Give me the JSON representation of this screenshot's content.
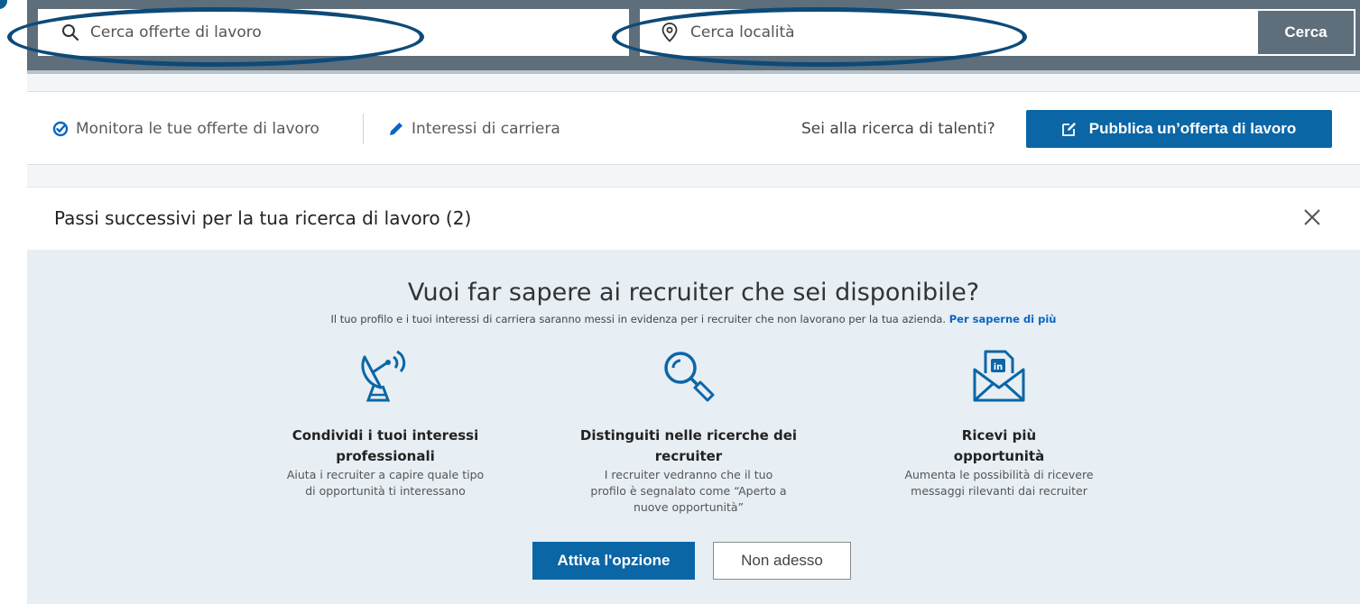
{
  "search": {
    "job_placeholder": "Cerca offerte di lavoro",
    "location_placeholder": "Cerca località",
    "button_label": "Cerca"
  },
  "nav": {
    "track_jobs": "Monitora le tue offerte di lavoro",
    "career_interests": "Interessi di carriera",
    "talent_question": "Sei alla ricerca di talenti?",
    "post_job": "Pubblica un’offerta di lavoro"
  },
  "next_steps": {
    "title": "Passi successivi per la tua ricerca di lavoro (2)"
  },
  "promo": {
    "title": "Vuoi far sapere ai recruiter che sei disponibile?",
    "description": "Il tuo profilo e i tuoi interessi di carriera saranno messi in evidenza per i recruiter che non lavorano per la tua azienda.",
    "learn_more": "Per saperne di più",
    "features": [
      {
        "icon": "satellite-dish-icon",
        "title": "Condividi i tuoi interessi professionali",
        "description": "Aiuta i recruiter a capire quale tipo di opportunità ti interessano"
      },
      {
        "icon": "magnifier-icon",
        "title": "Distinguiti nelle ricerche dei recruiter",
        "description": "I recruiter vedranno che il tuo profilo è segnalato come “Aperto a nuove opportunità”"
      },
      {
        "icon": "linkedin-envelope-icon",
        "title": "Ricevi più opportunità",
        "description": "Aumenta le possibilità di ricevere messaggi rilevanti dai recruiter"
      }
    ],
    "activate_label": "Attiva l'opzione",
    "later_label": "Non adesso"
  },
  "colors": {
    "brand_blue": "#0b66a6",
    "topbar": "#5e6e7b",
    "annotation": "#0d4a78"
  }
}
